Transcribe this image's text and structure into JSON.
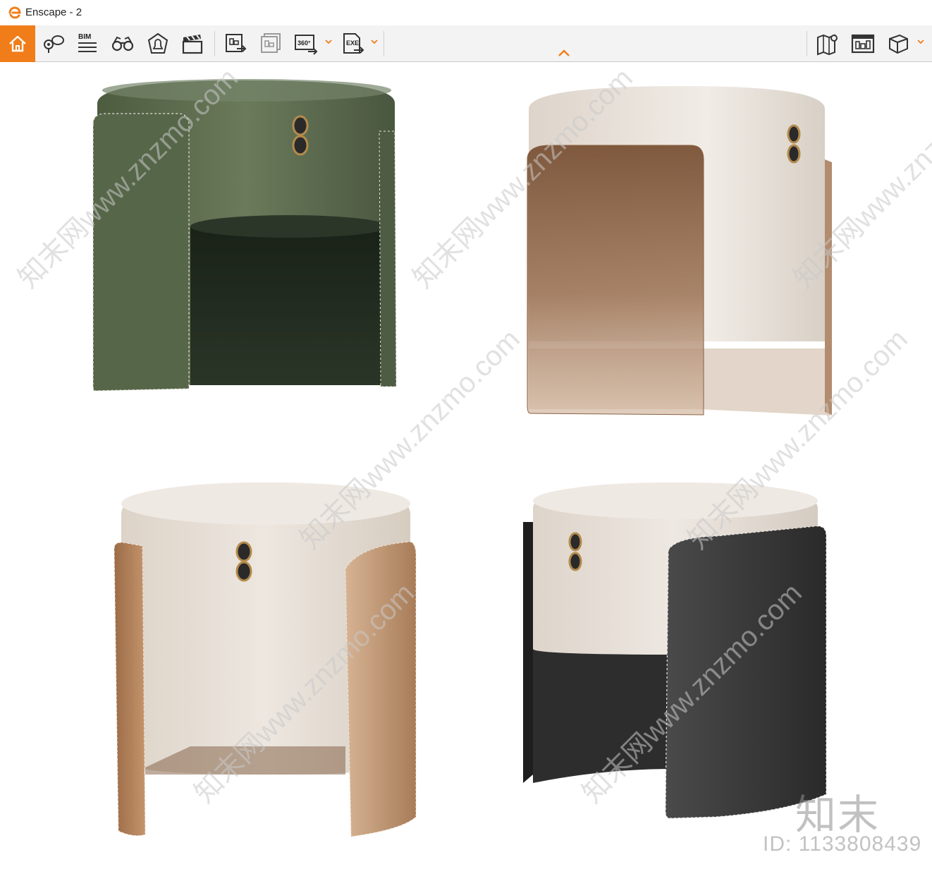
{
  "window": {
    "title": "Enscape - 2"
  },
  "toolbar": {
    "left_buttons": [
      {
        "name": "home",
        "tooltip": ""
      },
      {
        "name": "views",
        "tooltip": ""
      },
      {
        "name": "bim",
        "label": "BIM"
      },
      {
        "name": "binoculars",
        "tooltip": ""
      },
      {
        "name": "assets",
        "tooltip": ""
      },
      {
        "name": "video-editor",
        "tooltip": ""
      }
    ],
    "export_buttons": [
      {
        "name": "screenshot",
        "tooltip": ""
      },
      {
        "name": "batch-render",
        "tooltip": ""
      },
      {
        "name": "panorama",
        "label": "360°"
      },
      {
        "name": "export-exe",
        "label": "EXE"
      }
    ],
    "right_buttons": [
      {
        "name": "map",
        "tooltip": ""
      },
      {
        "name": "asset-library",
        "tooltip": ""
      },
      {
        "name": "cube-settings",
        "tooltip": ""
      }
    ]
  },
  "colors": {
    "accent": "#f07d1a",
    "toolbar_bg": "#f3f3f3",
    "viewport_bg": "#ffffff",
    "green_velvet": "#5f6f4f",
    "cream_fabric": "#e7e0d8",
    "tan_leather": "#b48563",
    "dark_leather": "#3a3a3a",
    "amber_glass": "#a57a55"
  },
  "render": {
    "watermark_text": "知末网www.znzmo.com",
    "brand_mark": "知末",
    "brand_id": "ID: 1133808439"
  }
}
